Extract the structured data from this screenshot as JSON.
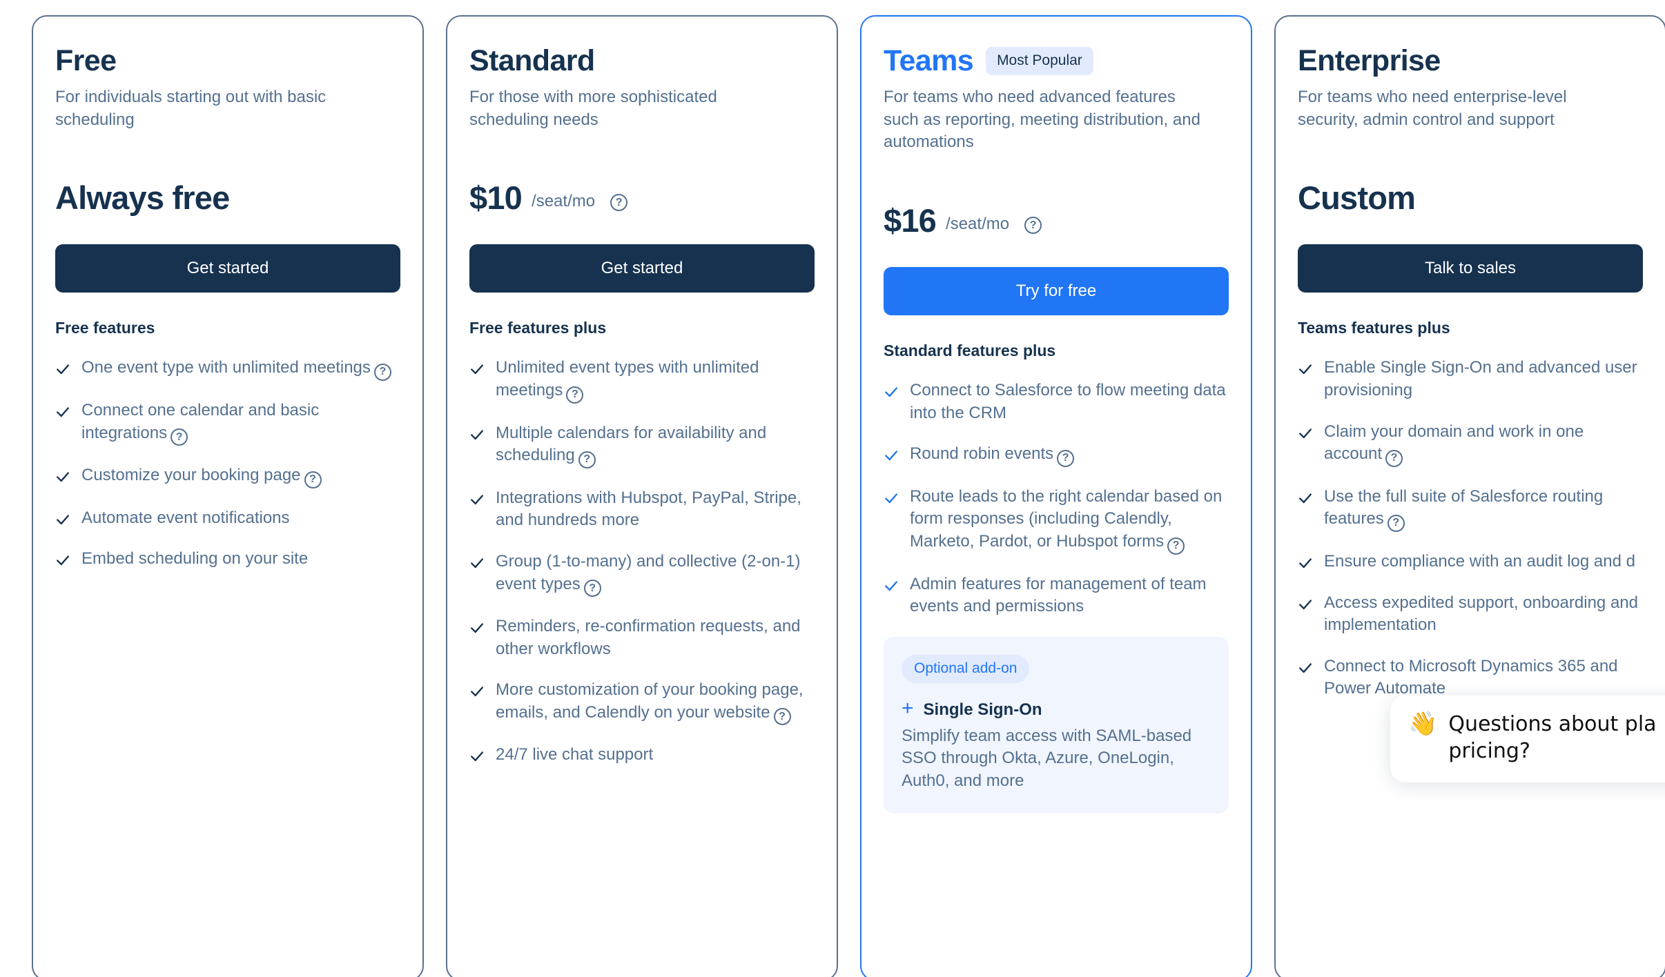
{
  "icons": {
    "check": "check-icon",
    "help": "help-circle-icon",
    "plus": "plus-icon",
    "wave": "waving-hand-emoji"
  },
  "colors": {
    "navy": "#16324f",
    "slate": "#54708f",
    "accent_blue": "#2176f5",
    "badge_bg": "#e2ebfd",
    "panel_bg": "#f1f5fe"
  },
  "help_symbol": "?",
  "plus_symbol": "+",
  "plans": [
    {
      "name": "Free",
      "badge": null,
      "description": "For individuals starting out with basic scheduling",
      "price": "Always free",
      "price_unit": null,
      "price_has_help": false,
      "cta": "Get started",
      "cta_style": "dark",
      "features_title": "Free features",
      "features": [
        {
          "text": "One event type with unlimited meetings",
          "help": true
        },
        {
          "text": "Connect one calendar and basic integrations",
          "help": true
        },
        {
          "text": "Customize your booking page",
          "help": true
        },
        {
          "text": "Automate event notifications",
          "help": false
        },
        {
          "text": "Embed scheduling on your site",
          "help": false
        }
      ],
      "addon": null
    },
    {
      "name": "Standard",
      "badge": null,
      "description": "For those with more sophisticated scheduling needs",
      "price": "$10",
      "price_unit": "/seat/mo",
      "price_has_help": true,
      "cta": "Get started",
      "cta_style": "dark",
      "features_title": "Free features plus",
      "features": [
        {
          "text": "Unlimited event types with unlimited meetings",
          "help": true
        },
        {
          "text": "Multiple calendars for availability and scheduling",
          "help": true
        },
        {
          "text": "Integrations with Hubspot, PayPal, Stripe, and hundreds more",
          "help": false
        },
        {
          "text": "Group (1-to-many) and collective (2-on-1) event types",
          "help": true
        },
        {
          "text": "Reminders, re-confirmation requests, and other workflows",
          "help": false
        },
        {
          "text": "More customization of your booking page, emails, and Calendly on your website",
          "help": true
        },
        {
          "text": "24/7 live chat support",
          "help": false
        }
      ],
      "addon": null
    },
    {
      "name": "Teams",
      "badge": "Most Popular",
      "description": "For teams who need advanced features such as reporting, meeting distribution, and automations",
      "price": "$16",
      "price_unit": "/seat/mo",
      "price_has_help": true,
      "cta": "Try for free",
      "cta_style": "primary",
      "features_title": "Standard features plus",
      "features": [
        {
          "text": "Connect to Salesforce to flow meeting data into the CRM",
          "help": false
        },
        {
          "text": "Round robin events",
          "help": true
        },
        {
          "text": "Route leads to the right calendar based on form responses (including Calendly, Marketo, Pardot, or Hubspot forms",
          "help": true
        },
        {
          "text": "Admin features for management of team events and permissions",
          "help": false
        }
      ],
      "addon": {
        "badge": "Optional add-on",
        "title": "Single Sign-On",
        "description": "Simplify team access with SAML-based SSO through Okta, Azure, OneLogin, Auth0, and more"
      }
    },
    {
      "name": "Enterprise",
      "badge": null,
      "description": "For teams who need enterprise-level security, admin control and support",
      "price": "Custom",
      "price_unit": null,
      "price_has_help": false,
      "cta": "Talk to sales",
      "cta_style": "dark",
      "features_title": "Teams features plus",
      "features": [
        {
          "text": "Enable Single Sign-On and advanced user provisioning",
          "help": false
        },
        {
          "text": "Claim your domain and work in one account",
          "help": true
        },
        {
          "text": "Use the full suite of Salesforce routing features",
          "help": true
        },
        {
          "text": "Ensure compliance with an audit log and d",
          "help": false
        },
        {
          "text": "Access expedited support, onboarding and implementation",
          "help": false
        },
        {
          "text": "Connect to Microsoft Dynamics 365 and Power Automate",
          "help": false
        }
      ],
      "addon": null
    }
  ],
  "chat_widget": {
    "emoji": "👋",
    "message": "Questions about pla pricing?"
  }
}
